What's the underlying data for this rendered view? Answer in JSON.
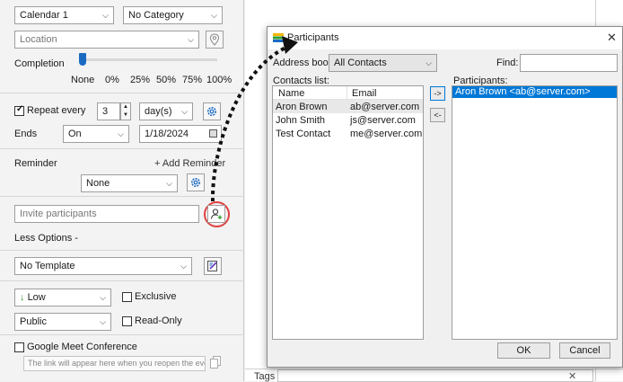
{
  "event_form": {
    "calendar": "Calendar 1",
    "category": "No Category",
    "location_placeholder": "Location",
    "completion_label": "Completion",
    "completion_ticks": [
      "None",
      "0%",
      "25%",
      "50%",
      "75%",
      "100%"
    ],
    "completion_value": "None",
    "repeat_label": "Repeat every",
    "repeat_checked": true,
    "repeat_count": "3",
    "repeat_unit": "day(s)",
    "ends_label": "Ends",
    "ends_mode": "On",
    "ends_date": "1/18/2024",
    "reminder_label": "Reminder",
    "add_reminder_label": "+ Add Reminder",
    "reminder_value": "None",
    "invite_placeholder": "Invite participants",
    "less_options_label": "Less Options -",
    "template_value": "No Template",
    "priority_value": "Low",
    "exclusive_label": "Exclusive",
    "visibility_value": "Public",
    "readonly_label": "Read-Only",
    "meet_label": "Google Meet Conference",
    "meet_link_placeholder": "The link will appear here when you reopen the event",
    "tags_label": "Tags"
  },
  "dialog": {
    "title": "Participants",
    "address_book_label": "Address book:",
    "address_book_value": "All Contacts",
    "find_label": "Find:",
    "find_value": "",
    "contacts_label": "Contacts list:",
    "columns": [
      "Name",
      "Email"
    ],
    "contacts": [
      {
        "name": "Aron Brown",
        "email": "ab@server.com"
      },
      {
        "name": "John Smith",
        "email": "js@server.com"
      },
      {
        "name": "Test Contact",
        "email": "me@server.com"
      }
    ],
    "add_button": "->",
    "remove_button": "<-",
    "participants_label": "Participants:",
    "participants": [
      "Aron Brown <ab@server.com>"
    ],
    "ok_label": "OK",
    "cancel_label": "Cancel"
  },
  "colors": {
    "selection": "#0078d7",
    "accent_blue": "#1a6ac2",
    "highlight_ring": "#e04040",
    "priority_arrow": "#2e9e2e"
  }
}
